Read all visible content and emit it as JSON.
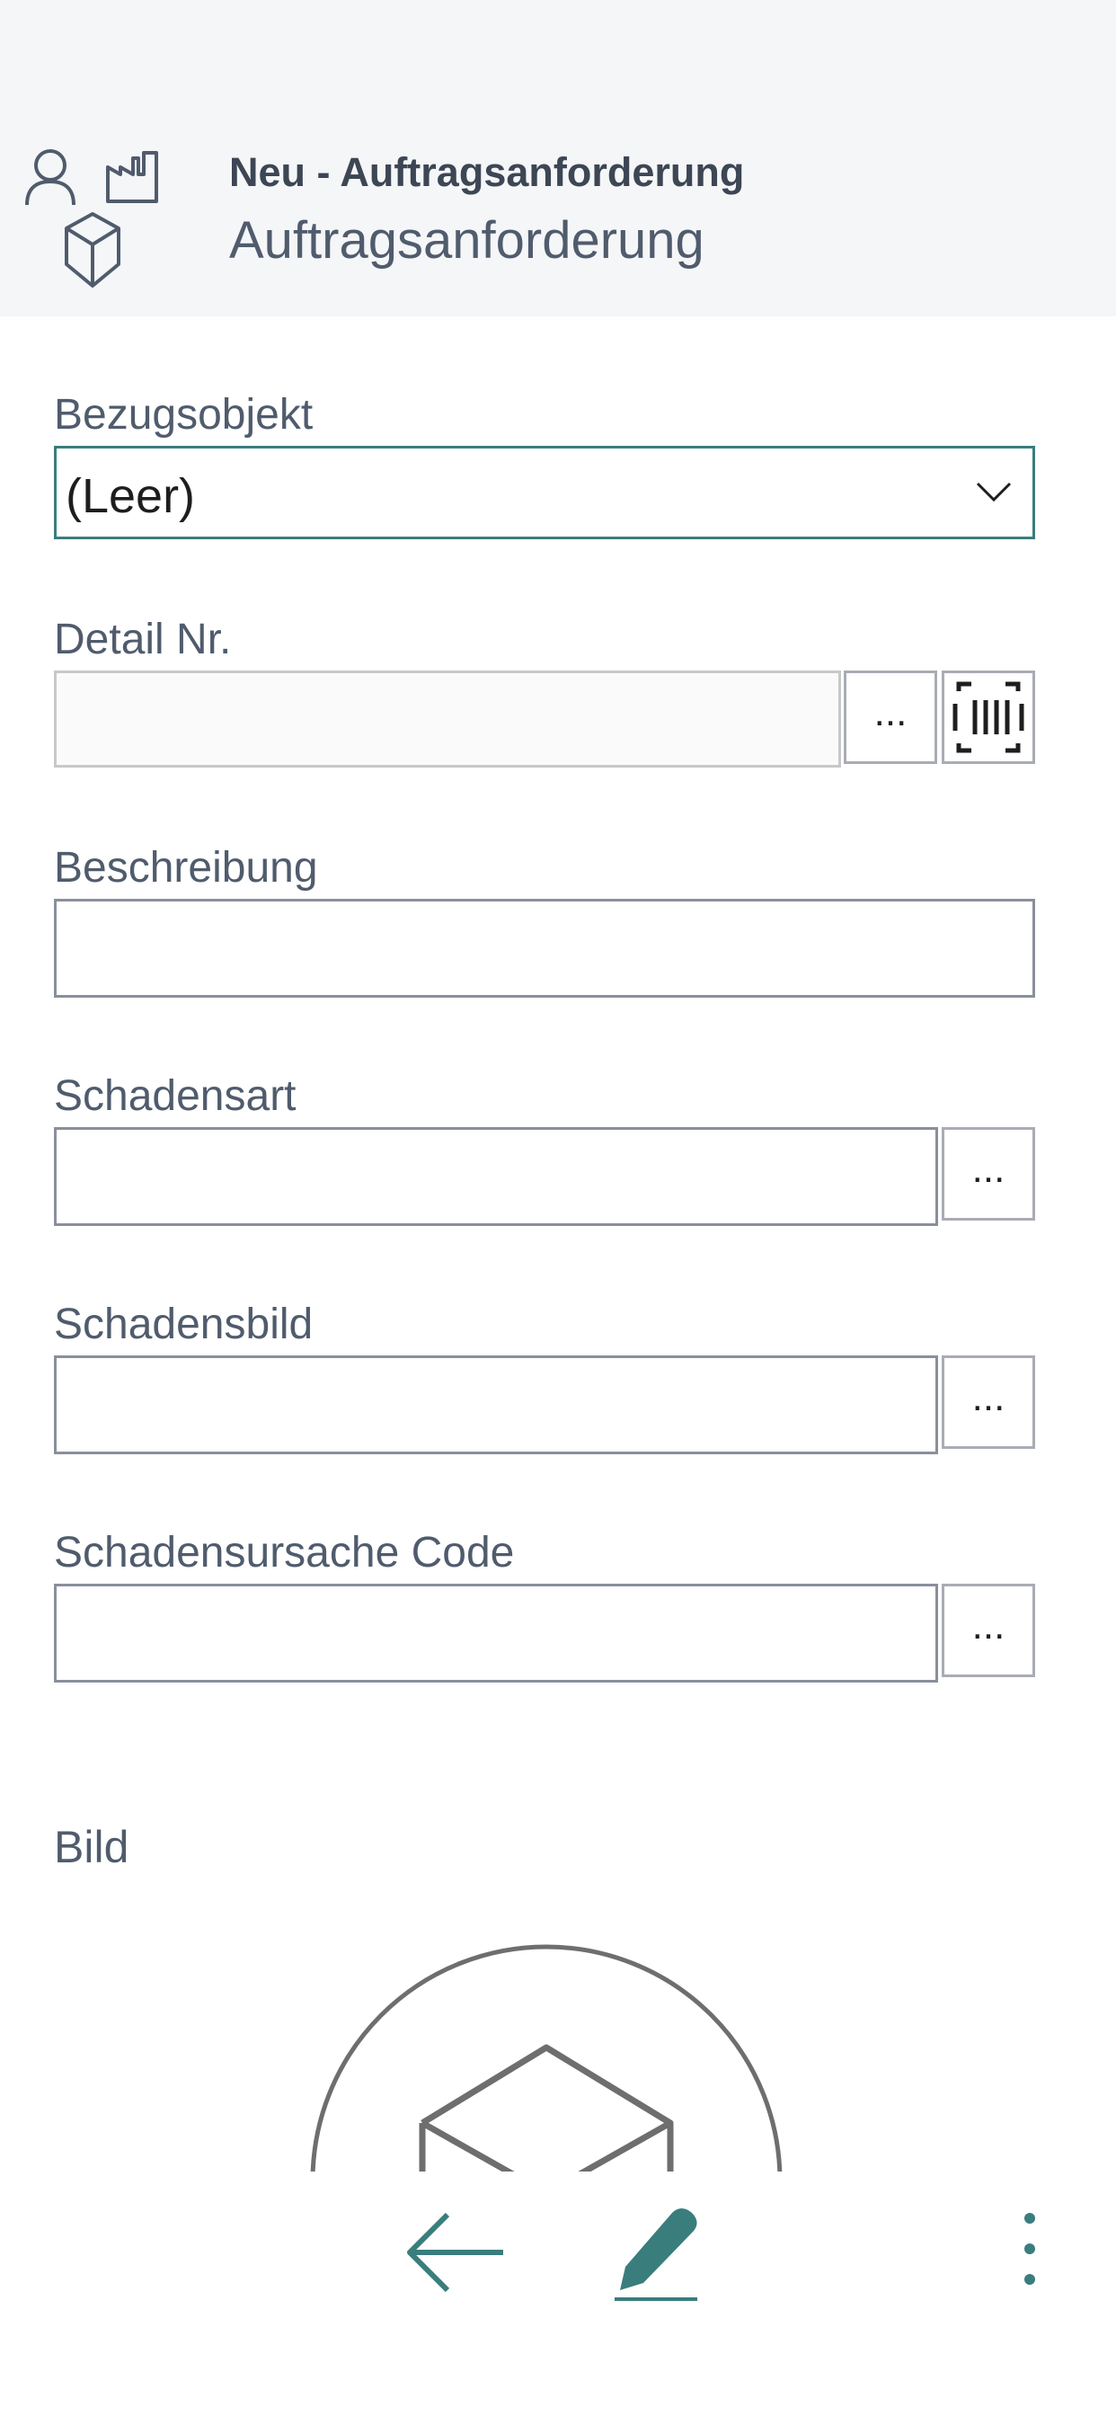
{
  "header": {
    "subtitle": "Neu - Auftragsanforderung",
    "title": "Auftragsanforderung",
    "icons": [
      "person-icon",
      "factory-icon",
      "cube-icon"
    ]
  },
  "form": {
    "bezugsobjekt": {
      "label": "Bezugsobjekt",
      "value": "(Leer)"
    },
    "detail_nr": {
      "label": "Detail Nr.",
      "value": "",
      "lookup_label": "..."
    },
    "beschreibung": {
      "label": "Beschreibung",
      "value": ""
    },
    "schadensart": {
      "label": "Schadensart",
      "value": "",
      "lookup_label": "..."
    },
    "schadensbild": {
      "label": "Schadensbild",
      "value": "",
      "lookup_label": "..."
    },
    "schadensursache_code": {
      "label": "Schadensursache Code",
      "value": "",
      "lookup_label": "..."
    },
    "bild": {
      "label": "Bild"
    }
  },
  "toolbar": {
    "icons": [
      "back-arrow-icon",
      "edit-pencil-icon",
      "more-vertical-icon"
    ]
  },
  "colors": {
    "accent": "#3a7d7d",
    "header_bg": "#f5f6f8",
    "label_text": "#505c6d"
  }
}
